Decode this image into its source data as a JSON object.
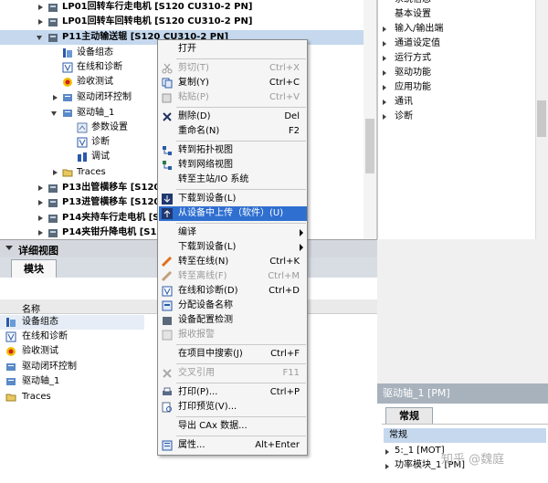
{
  "project_tree": {
    "items": [
      {
        "label": "LP01回转车行走电机 [S120 CU310-2 PN]",
        "bold": true
      },
      {
        "label": "LP01回转车回转电机 [S120 CU310-2 PN]",
        "bold": true
      },
      {
        "label": "P11主动输送辊 [S120 CU310-2 PN]",
        "bold": true
      },
      {
        "label": "设备组态"
      },
      {
        "label": "在线和诊断"
      },
      {
        "label": "验收测试"
      },
      {
        "label": "驱动闭环控制"
      },
      {
        "label": "驱动轴_1"
      },
      {
        "label": "参数设置"
      },
      {
        "label": "诊断"
      },
      {
        "label": "调试"
      },
      {
        "label": "Traces"
      },
      {
        "label": "P13出管横移车 [S120",
        "bold": true
      },
      {
        "label": "P13进管横移车 [S120",
        "bold": true
      },
      {
        "label": "P14夹持车行走电机 [S120",
        "bold": true
      },
      {
        "label": "P14夹钳升降电机 [S1",
        "bold": true
      }
    ]
  },
  "right_nav": {
    "items": [
      "系统信息",
      "基本设置",
      "输入/输出端",
      "通道设定值",
      "运行方式",
      "驱动功能",
      "应用功能",
      "通讯",
      "诊断"
    ]
  },
  "detail_view": {
    "title": "详细视图",
    "tab": "模块",
    "column_name": "名称",
    "rows": [
      "设备组态",
      "在线和诊断",
      "验收测试",
      "驱动闭环控制",
      "驱动轴_1",
      "Traces"
    ]
  },
  "properties": {
    "title": "驱动轴_1 [PM]",
    "tab": "常规",
    "items": [
      "常规",
      "5:_1 [MOT]",
      "功率模块_1 [PM]"
    ]
  },
  "context_menu": {
    "items": [
      {
        "label": "打开",
        "shortcut": ""
      },
      {
        "label": "剪切(T)",
        "shortcut": "Ctrl+X",
        "disabled": true
      },
      {
        "label": "复制(Y)",
        "shortcut": "Ctrl+C"
      },
      {
        "label": "粘贴(P)",
        "shortcut": "Ctrl+V",
        "disabled": true
      },
      {
        "label": "删除(D)",
        "shortcut": "Del"
      },
      {
        "label": "重命名(N)",
        "shortcut": "F2"
      },
      {
        "label": "转到拓扑视图",
        "shortcut": ""
      },
      {
        "label": "转到网络视图",
        "shortcut": ""
      },
      {
        "label": "转至主站/IO 系统",
        "shortcut": ""
      },
      {
        "label": "下载到设备(L)",
        "shortcut": ""
      },
      {
        "label": "从设备中上传（软件）(U)",
        "shortcut": "",
        "highlighted": true
      },
      {
        "label": "编译",
        "shortcut": ""
      },
      {
        "label": "下载到设备(L)",
        "shortcut": ""
      },
      {
        "label": "转至在线(N)",
        "shortcut": "Ctrl+K"
      },
      {
        "label": "转至离线(F)",
        "shortcut": "Ctrl+M",
        "disabled": true
      },
      {
        "label": "在线和诊断(D)",
        "shortcut": "Ctrl+D"
      },
      {
        "label": "分配设备名称",
        "shortcut": ""
      },
      {
        "label": "设备配置检测",
        "shortcut": ""
      },
      {
        "label": "报收报警",
        "shortcut": "",
        "disabled": true
      },
      {
        "label": "在项目中搜索(J)",
        "shortcut": "Ctrl+F"
      },
      {
        "label": "交叉引用",
        "shortcut": "F11",
        "disabled": true
      },
      {
        "label": "打印(P)...",
        "shortcut": "Ctrl+P"
      },
      {
        "label": "打印预览(V)...",
        "shortcut": ""
      },
      {
        "label": "导出 CAx 数据...",
        "shortcut": ""
      },
      {
        "label": "属性...",
        "shortcut": "Alt+Enter"
      }
    ]
  },
  "watermark": "知乎 @魏庭"
}
